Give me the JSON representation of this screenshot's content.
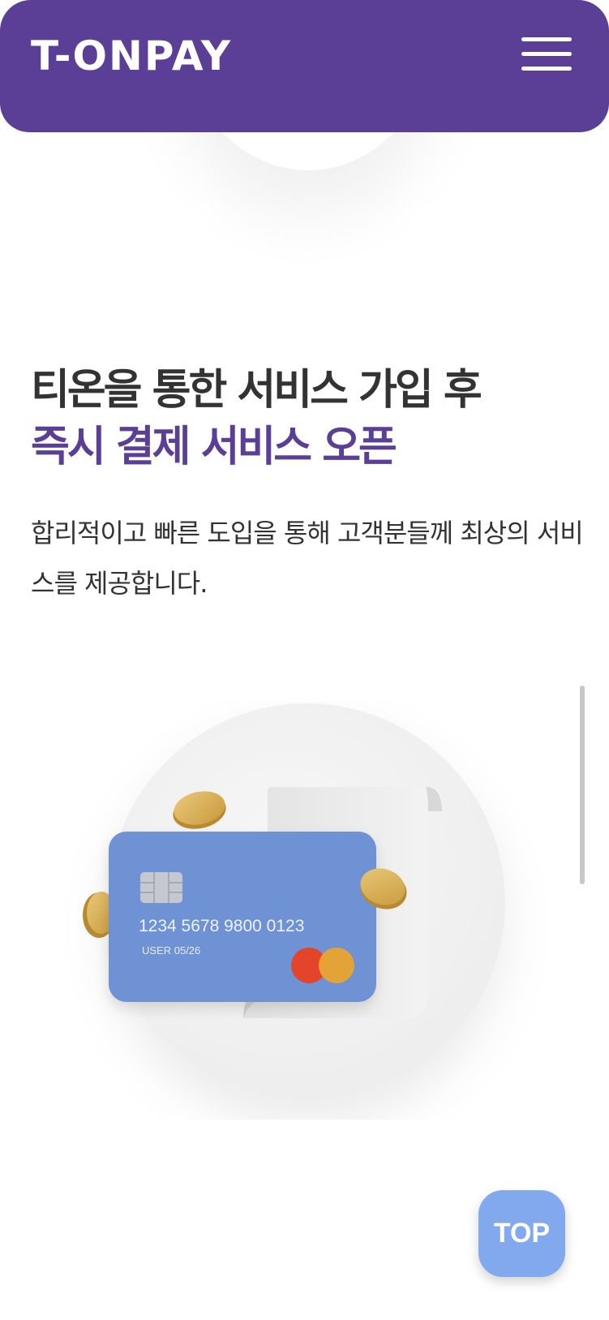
{
  "header": {
    "logo": "T-ONPAY",
    "menu_icon": "hamburger-menu-icon",
    "bg_color": "#5b3e96"
  },
  "hero": {
    "headline_line1": "티온을 통한 서비스 가입 후",
    "headline_line2": "즉시 결제 서비스 오픈",
    "description": "합리적이고 빠른 도입을 통해 고객분들께 최상의 서비스를 제공합니다."
  },
  "illustration": {
    "card_number": "1234 5678 9800 0123",
    "card_holder": "USER 05/26",
    "card_color": "#6e92d4"
  },
  "top_button": {
    "label": "TOP",
    "color": "#82a9ee"
  },
  "accent_color": "#5b3e96"
}
